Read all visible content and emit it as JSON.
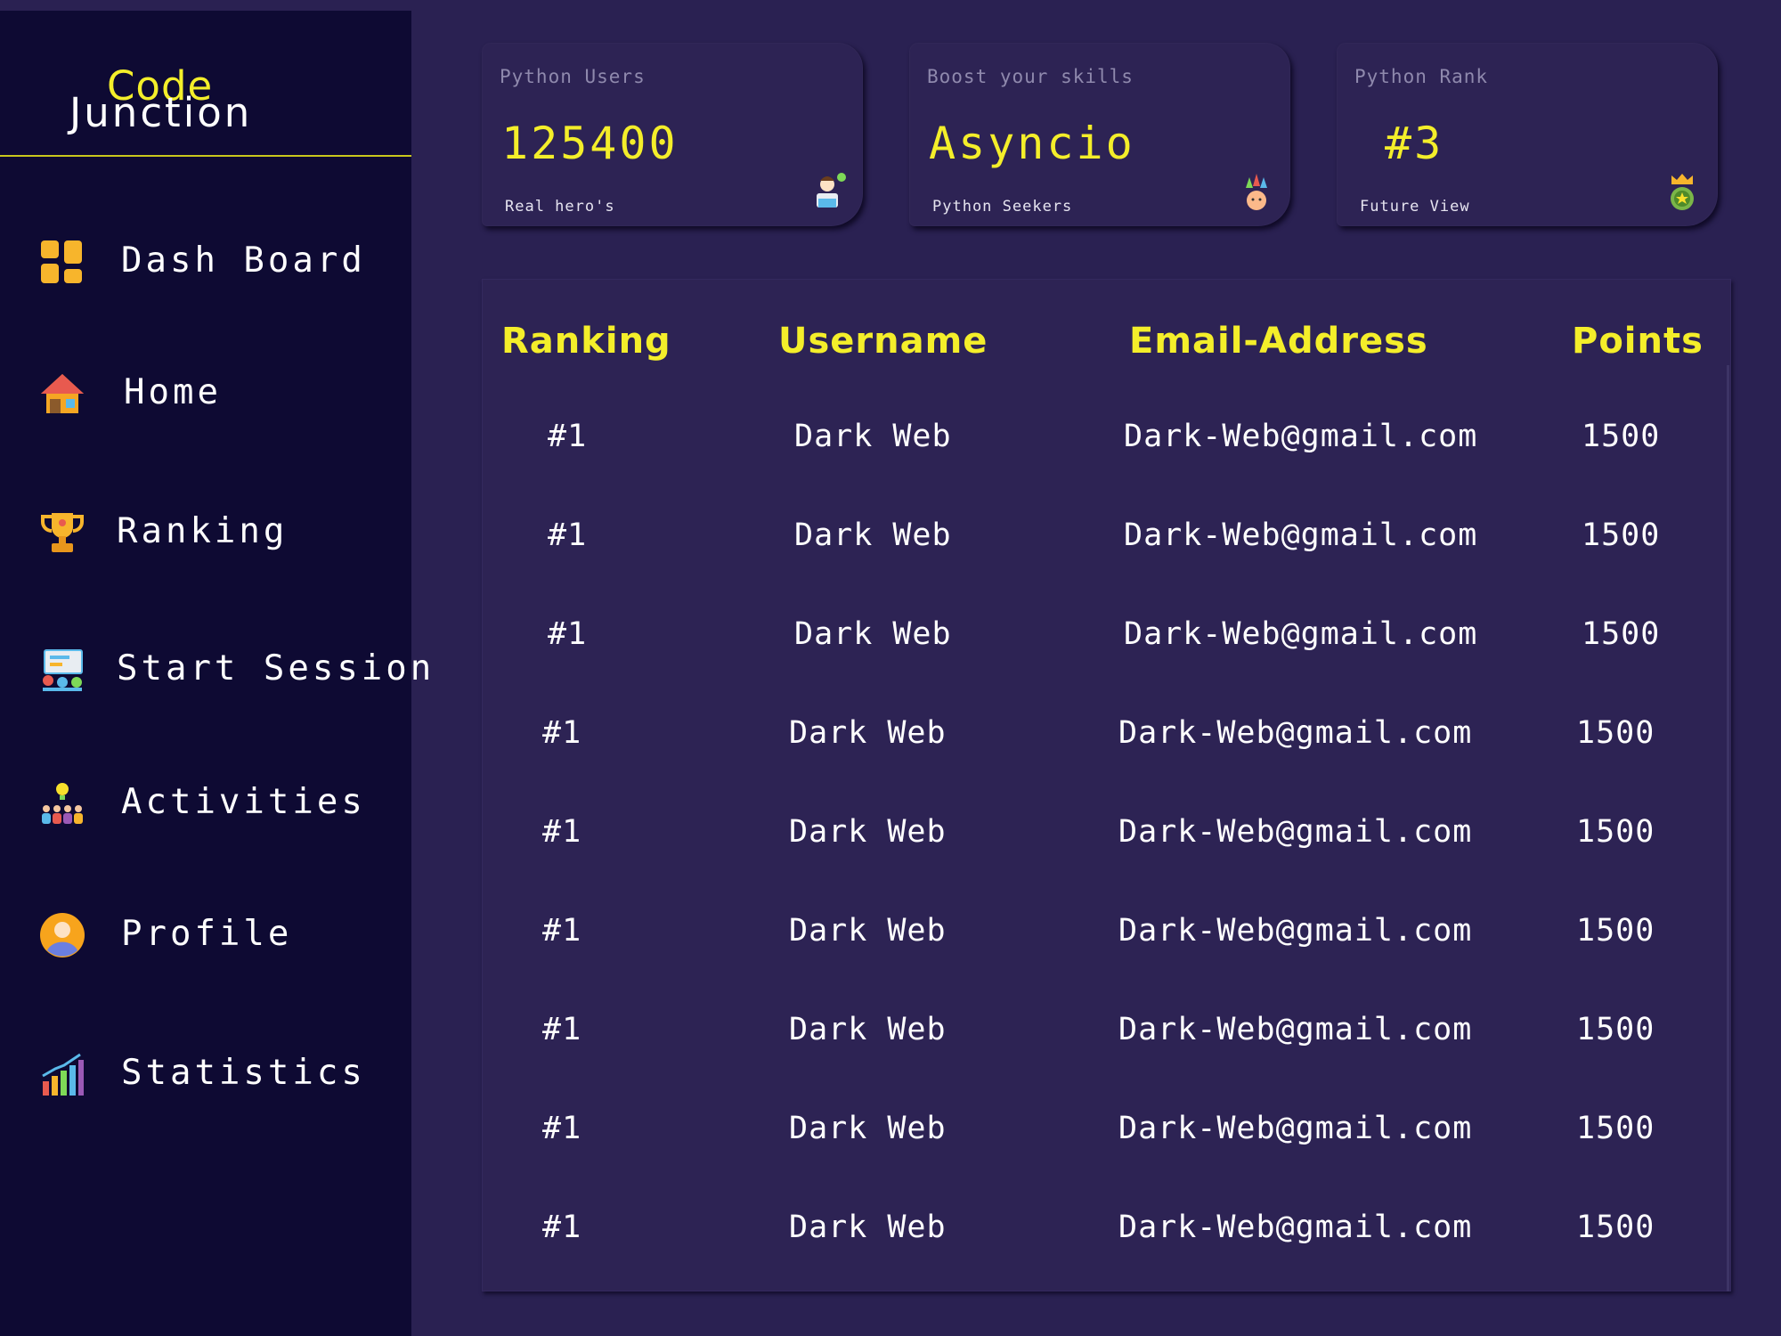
{
  "brand": {
    "line1": "Code",
    "line2": "Junction"
  },
  "nav": [
    {
      "label": "Dash Board",
      "icon": "dashboard-icon"
    },
    {
      "label": "Home",
      "icon": "home-icon"
    },
    {
      "label": "Ranking",
      "icon": "trophy-icon"
    },
    {
      "label": "Start Session",
      "icon": "presentation-icon"
    },
    {
      "label": "Activities",
      "icon": "team-idea-icon"
    },
    {
      "label": "Profile",
      "icon": "user-avatar-icon"
    },
    {
      "label": "Statistics",
      "icon": "bar-chart-icon"
    }
  ],
  "cards": [
    {
      "title": "Python Users",
      "value": "125400",
      "subtitle": "Real hero's",
      "icon": "developer-icon"
    },
    {
      "title": "Boost your skills",
      "value": "Asyncio",
      "subtitle": "Python Seekers",
      "icon": "growth-icon"
    },
    {
      "title": "Python Rank",
      "value": "#3",
      "subtitle": "Future View",
      "icon": "crown-medal-icon"
    }
  ],
  "table": {
    "headers": [
      "Ranking",
      "Username",
      "Email-Address",
      "Points"
    ],
    "rows": [
      {
        "rank": "#1",
        "username": "Dark Web",
        "email": "Dark-Web@gmail.com",
        "points": "1500"
      },
      {
        "rank": "#1",
        "username": "Dark Web",
        "email": "Dark-Web@gmail.com",
        "points": "1500"
      },
      {
        "rank": "#1",
        "username": "Dark Web",
        "email": "Dark-Web@gmail.com",
        "points": "1500"
      },
      {
        "rank": "#1",
        "username": "Dark Web",
        "email": "Dark-Web@gmail.com",
        "points": "1500"
      },
      {
        "rank": "#1",
        "username": "Dark Web",
        "email": "Dark-Web@gmail.com",
        "points": "1500"
      },
      {
        "rank": "#1",
        "username": "Dark Web",
        "email": "Dark-Web@gmail.com",
        "points": "1500"
      },
      {
        "rank": "#1",
        "username": "Dark Web",
        "email": "Dark-Web@gmail.com",
        "points": "1500"
      },
      {
        "rank": "#1",
        "username": "Dark Web",
        "email": "Dark-Web@gmail.com",
        "points": "1500"
      },
      {
        "rank": "#1",
        "username": "Dark Web",
        "email": "Dark-Web@gmail.com",
        "points": "1500"
      }
    ]
  },
  "colors": {
    "background": "#2a2152",
    "sidebar": "#0e0a33",
    "accent": "#f4ee2a",
    "text": "#ffffff"
  }
}
